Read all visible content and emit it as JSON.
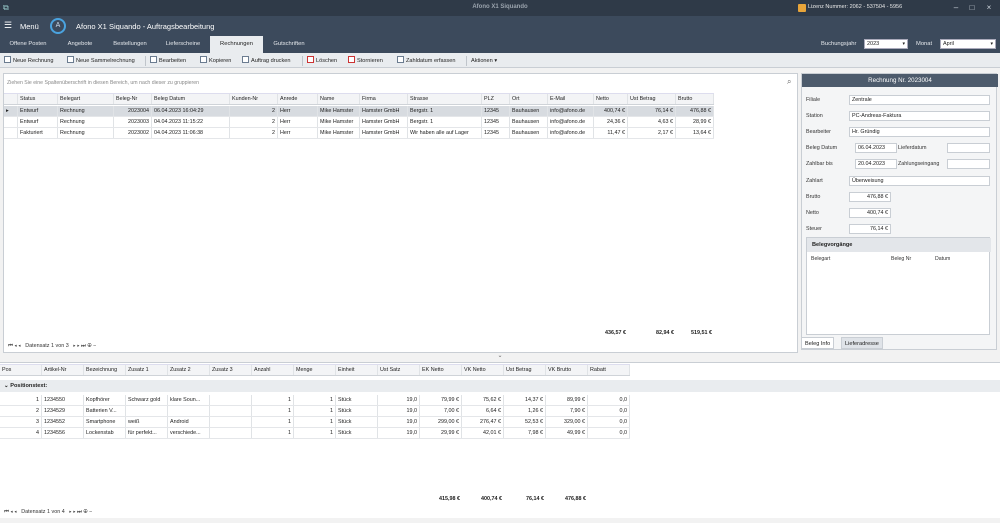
{
  "window": {
    "title": "Afono X1 Siquando",
    "license": "Lizenz Nummer: 2062 - 537504 - 5956"
  },
  "header": {
    "menu_label": "Menü",
    "app_title": "Afono X1 Siquando - Auftragsbearbeitung"
  },
  "tabs": [
    "Offene Posten",
    "Angebote",
    "Bestellungen",
    "Lieferscheine",
    "Rechnungen",
    "Gutschriften"
  ],
  "active_tab": "Rechnungen",
  "filters": {
    "year_label": "Buchungsjahr",
    "year_value": "2023",
    "month_label": "Monat",
    "month_value": "April"
  },
  "toolbar": [
    "Neue Rechnung",
    "Neue Sammelrechnung",
    "Bearbeiten",
    "Kopieren",
    "Auftrag drucken",
    "Löschen",
    "Stornieren",
    "Zahldatum erfassen",
    "Aktionen"
  ],
  "grid1": {
    "group_hint": "Ziehen Sie eine Spaltenüberschrift in diesen Bereich, um nach dieser zu gruppieren",
    "columns": [
      "Status",
      "Belegart",
      "Beleg-Nr",
      "Beleg Datum",
      "Kunden-Nr",
      "Anrede",
      "Name",
      "Firma",
      "Strasse",
      "PLZ",
      "Ort",
      "E-Mail",
      "Netto",
      "Ust Betrag",
      "Brutto"
    ],
    "rows": [
      [
        "Entwurf",
        "Rechnung",
        "2023004",
        "06.04.2023 16:04:29",
        "2",
        "Herr",
        "Mike Hamster",
        "Hamster GmbH",
        "Bergstr. 1",
        "12345",
        "Bauhausen",
        "info@afono.de",
        "400,74 €",
        "76,14 €",
        "476,88 €"
      ],
      [
        "Entwurf",
        "Rechnung",
        "2023003",
        "04.04.2023 11:15:22",
        "2",
        "Herr",
        "Mike Hamster",
        "Hamster GmbH",
        "Bergstr. 1",
        "12345",
        "Bauhausen",
        "info@afono.de",
        "24,36 €",
        "4,63 €",
        "28,99 €"
      ],
      [
        "Fakturiert",
        "Rechnung",
        "2023002",
        "04.04.2023 11:06:38",
        "2",
        "Herr",
        "Mike Hamster",
        "Hamster GmbH",
        "Wir haben alle auf Lager",
        "12345",
        "Bauhausen",
        "info@afono.de",
        "11,47 €",
        "2,17 €",
        "13,64 €"
      ]
    ],
    "totals": {
      "netto": "436,57 €",
      "ust": "82,94 €",
      "brutto": "519,51 €"
    },
    "nav_text": "Datensatz 1 von 3"
  },
  "details": {
    "title": "Rechnung Nr. 2023004",
    "filiale_label": "Filiale",
    "filiale": "Zentrale",
    "station_label": "Station",
    "station": "PC-Andreas-Faktura",
    "bearbeiter_label": "Bearbeiter",
    "bearbeiter": "Hr. Gründig",
    "beleg_datum_label": "Beleg Datum",
    "beleg_datum": "06.04.2023",
    "lieferdatum_label": "Lieferdatum",
    "lieferdatum": "",
    "zahlbar_bis_label": "Zahlbar bis",
    "zahlbar_bis": "20.04.2023",
    "zahlungseingang_label": "Zahlungseingang",
    "zahlungseingang": "",
    "zahlart_label": "Zahlart",
    "zahlart": "Überweisung",
    "brutto_label": "Brutto",
    "brutto": "476,88 €",
    "netto_label": "Netto",
    "netto": "400,74 €",
    "steuer_label": "Steuer",
    "steuer": "76,14 €",
    "belegvorgaenge_title": "Belegvorgänge",
    "bv_columns": [
      "Belegart",
      "Beleg Nr",
      "Datum"
    ],
    "tabs": [
      "Beleg Info",
      "Lieferadresse"
    ]
  },
  "grid2": {
    "columns": [
      "Pos",
      "Artikel-Nr",
      "Bezeichnung",
      "Zusatz 1",
      "Zusatz 2",
      "Zusatz 3",
      "Anzahl",
      "Menge",
      "Einheit",
      "Ust Satz",
      "EK Netto",
      "VK Netto",
      "Ust Betrag",
      "VK Brutto",
      "Rabatt"
    ],
    "group_label": "Positionstext:",
    "rows": [
      [
        "1",
        "1234550",
        "Kopfhörer",
        "Schwarz gold",
        "klare Soun...",
        "",
        "1",
        "1",
        "Stück",
        "19,0",
        "79,99 €",
        "75,62 €",
        "14,37 €",
        "89,99 €",
        "0,0"
      ],
      [
        "2",
        "1234529",
        "Batterien V...",
        "",
        "",
        "",
        "1",
        "1",
        "Stück",
        "19,0",
        "7,00 €",
        "6,64 €",
        "1,26 €",
        "7,90 €",
        "0,0"
      ],
      [
        "3",
        "1234552",
        "Smartphone",
        "weiß",
        "Android",
        "",
        "1",
        "1",
        "Stück",
        "19,0",
        "299,00 €",
        "276,47 €",
        "52,53 €",
        "329,00 €",
        "0,0"
      ],
      [
        "4",
        "1234556",
        "Lockenstab",
        "für perfekt...",
        "verschiede...",
        "",
        "1",
        "1",
        "Stück",
        "19,0",
        "29,99 €",
        "42,01 €",
        "7,98 €",
        "49,99 €",
        "0,0"
      ]
    ],
    "totals": {
      "ek_netto": "415,98 €",
      "vk_netto": "400,74 €",
      "ust": "76,14 €",
      "vk_brutto": "476,88 €"
    },
    "nav_text": "Datensatz 1 von 4"
  },
  "colors": {
    "header": "#3c4a5c",
    "titlebar": "#2f3a48",
    "accent": "#4d5b6c"
  }
}
